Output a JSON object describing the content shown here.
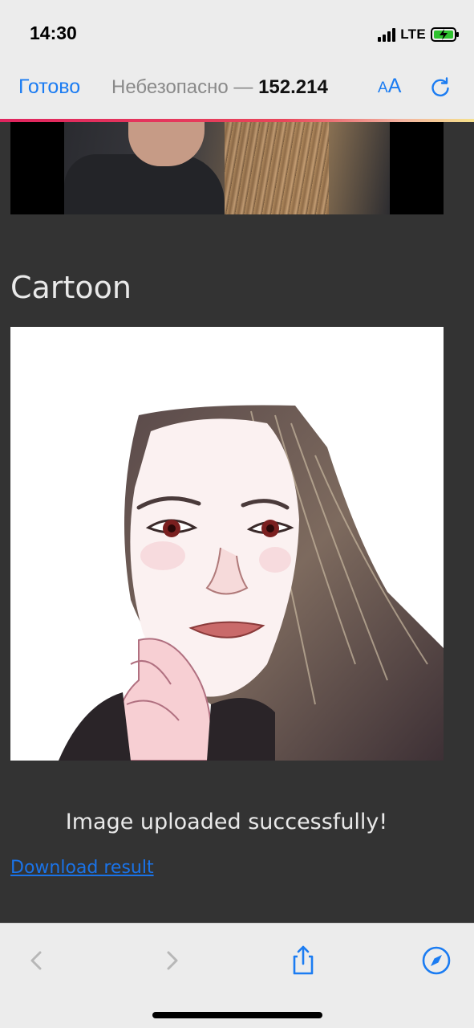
{
  "status_bar": {
    "time": "14:30",
    "network": "LTE",
    "icons": [
      "signal-icon",
      "battery-charging-icon"
    ]
  },
  "browser": {
    "done_label": "Готово",
    "address_prefix": "Небезопасно — ",
    "address_host": "152.214",
    "text_size_small": "A",
    "text_size_big": "A",
    "icons": [
      "reload-icon",
      "back-icon",
      "forward-icon",
      "share-icon",
      "compass-icon"
    ],
    "accent_color": "#1b7cf2"
  },
  "page": {
    "cartoon_heading": "Cartoon",
    "status_message": "Image uploaded successfully!",
    "download_label": "Download result",
    "background_color": "#333333",
    "text_color": "#e9e9e9",
    "link_color": "#1a73e8"
  }
}
